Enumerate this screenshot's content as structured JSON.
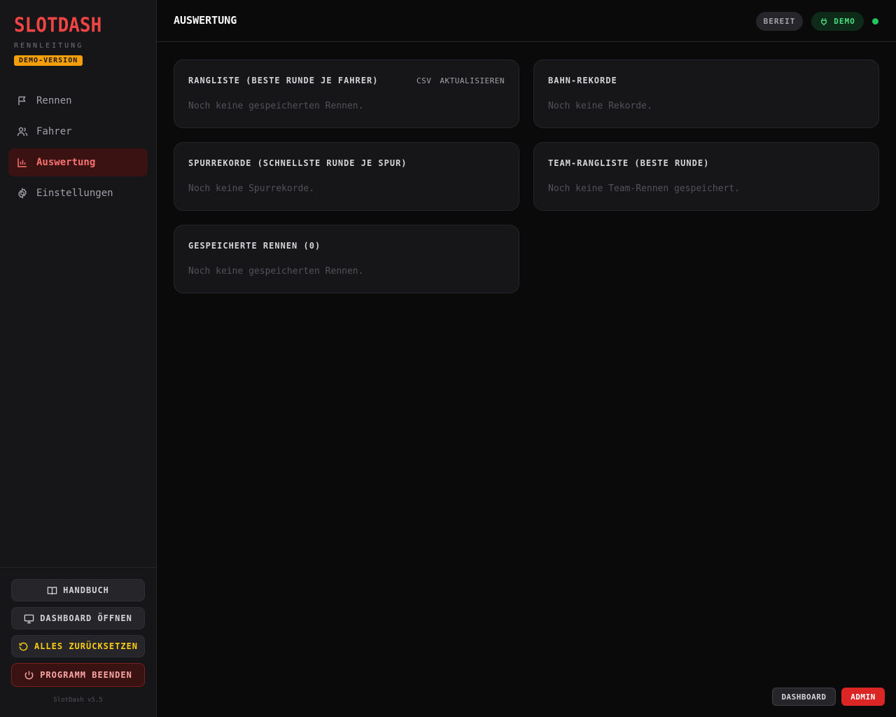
{
  "brand": {
    "title": "SLOTDASH",
    "subtitle": "RENNLEITUNG",
    "demo_tag": "DEMO-VERSION"
  },
  "sidebar": {
    "items": [
      {
        "label": "Rennen",
        "icon": "flag-icon"
      },
      {
        "label": "Fahrer",
        "icon": "users-icon"
      },
      {
        "label": "Auswertung",
        "icon": "bar-chart-icon",
        "active": true
      },
      {
        "label": "Einstellungen",
        "icon": "gear-icon"
      }
    ],
    "buttons": {
      "manual": "HANDBUCH",
      "open_dashboard": "DASHBOARD ÖFFNEN",
      "reset_all": "ALLES ZURÜCKSETZEN",
      "quit": "PROGRAMM BEENDEN"
    },
    "version": "SlotDash v5.5"
  },
  "header": {
    "title": "AUSWERTUNG",
    "status": "BEREIT",
    "mode": "DEMO",
    "status_color": "#22c55e"
  },
  "cards": {
    "leaderboard": {
      "title": "RANGLISTE (BESTE RUNDE JE FAHRER)",
      "empty": "Noch keine gespeicherten Rennen.",
      "action_csv": "CSV",
      "action_refresh": "AKTUALISIEREN"
    },
    "track_records": {
      "title": "BAHN-REKORDE",
      "empty": "Noch keine Rekorde."
    },
    "lane_records": {
      "title": "SPURREKORDE (SCHNELLSTE RUNDE JE SPUR)",
      "empty": "Noch keine Spurrekorde."
    },
    "team_leaderboard": {
      "title": "TEAM-RANGLISTE (BESTE RUNDE)",
      "empty": "Noch keine Team-Rennen gespeichert."
    },
    "saved_races": {
      "title": "GESPEICHERTE RENNEN (0)",
      "empty": "Noch keine gespeicherten Rennen."
    }
  },
  "footer": {
    "dashboard": "DASHBOARD",
    "admin": "ADMIN"
  },
  "colors": {
    "accent": "#ef4444",
    "warning": "#f59e0b",
    "success": "#4ade80"
  }
}
